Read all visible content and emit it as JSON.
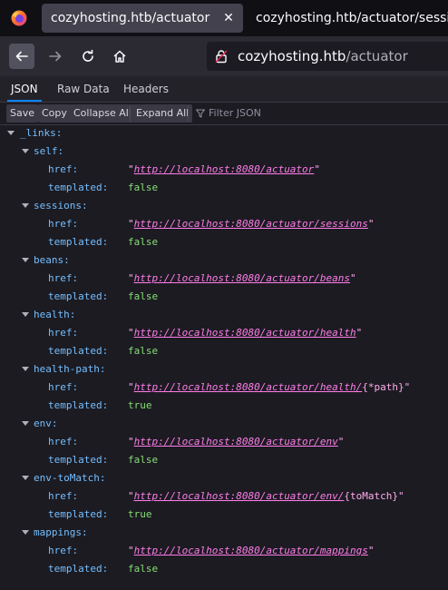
{
  "browser": {
    "tabs": [
      {
        "title": "cozyhosting.htb/actuator",
        "active": true
      },
      {
        "title": "cozyhosting.htb/actuator/sessions",
        "active": false
      }
    ],
    "close_glyph": "✕",
    "url": {
      "host": "cozyhosting.htb",
      "path": "/actuator"
    }
  },
  "viewer": {
    "tabs": [
      "JSON",
      "Raw Data",
      "Headers"
    ],
    "toolbar": {
      "save": "Save",
      "copy": "Copy",
      "collapse_all": "Collapse All",
      "expand_all": "Expand All",
      "filter_placeholder": "Filter JSON"
    }
  },
  "json": {
    "root_key": "_links:",
    "href_label": "href:",
    "templated_label": "templated:",
    "quote": "\"",
    "entries": [
      {
        "name": "self:",
        "href": "http://localhost:8080/actuator",
        "href_tail": "",
        "templated": "false"
      },
      {
        "name": "sessions:",
        "href": "http://localhost:8080/actuator/sessions",
        "href_tail": "",
        "templated": "false"
      },
      {
        "name": "beans:",
        "href": "http://localhost:8080/actuator/beans",
        "href_tail": "",
        "templated": "false"
      },
      {
        "name": "health:",
        "href": "http://localhost:8080/actuator/health",
        "href_tail": "",
        "templated": "false"
      },
      {
        "name": "health-path:",
        "href": "http://localhost:8080/actuator/health/",
        "href_tail": "{*path}",
        "templated": "true"
      },
      {
        "name": "env:",
        "href": "http://localhost:8080/actuator/env",
        "href_tail": "",
        "templated": "false"
      },
      {
        "name": "env-toMatch:",
        "href": "http://localhost:8080/actuator/env/",
        "href_tail": "{toMatch}",
        "templated": "true"
      },
      {
        "name": "mappings:",
        "href": "http://localhost:8080/actuator/mappings",
        "href_tail": "",
        "templated": "false"
      }
    ]
  },
  "colors": {
    "key": "#75bfff",
    "string": "#ff7de9",
    "boolean": "#86de74",
    "accent": "#0a84ff"
  },
  "icons": [
    "firefox-logo-icon",
    "close-icon",
    "back-arrow-icon",
    "forward-arrow-icon",
    "reload-icon",
    "home-icon",
    "lock-icon",
    "filter-icon",
    "twisty-icon"
  ]
}
